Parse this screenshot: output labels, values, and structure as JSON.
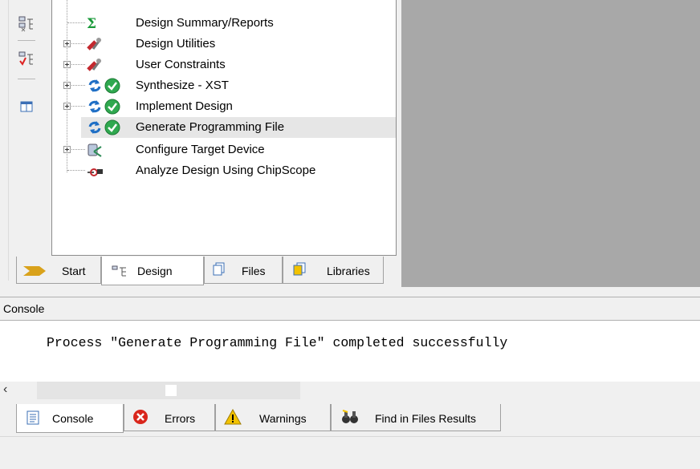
{
  "process_tree": {
    "items": [
      {
        "label": "Design Summary/Reports",
        "icon": "sigma-icon"
      },
      {
        "label": "Design Utilities",
        "icon": "tools-icon"
      },
      {
        "label": "User Constraints",
        "icon": "tools-icon"
      },
      {
        "label": "Synthesize - XST",
        "icon": "process-complete-icon"
      },
      {
        "label": "Implement Design",
        "icon": "process-complete-icon"
      },
      {
        "label": "Generate Programming File",
        "icon": "process-complete-icon"
      },
      {
        "label": "Configure Target Device",
        "icon": "device-icon"
      },
      {
        "label": "Analyze Design Using ChipScope",
        "icon": "chipscope-icon"
      }
    ]
  },
  "panel_tabs": [
    {
      "label": "Start",
      "icon": "start-arrow-icon"
    },
    {
      "label": "Design",
      "icon": "design-hierarchy-icon"
    },
    {
      "label": "Files",
      "icon": "files-icon"
    },
    {
      "label": "Libraries",
      "icon": "libraries-icon"
    }
  ],
  "console": {
    "title": "Console",
    "message": "Process \"Generate Programming File\" completed successfully"
  },
  "bottom_tabs": [
    {
      "label": "Console",
      "icon": "console-icon"
    },
    {
      "label": "Errors",
      "icon": "error-icon"
    },
    {
      "label": "Warnings",
      "icon": "warning-icon"
    },
    {
      "label": "Find in Files Results",
      "icon": "binoculars-icon"
    }
  ],
  "colors": {
    "workspace_gray": "#a8a8a8",
    "success_green": "#2fa84f",
    "sync_blue": "#1f6fc5",
    "error_red": "#d9261c",
    "warning_yellow": "#f2c200"
  }
}
